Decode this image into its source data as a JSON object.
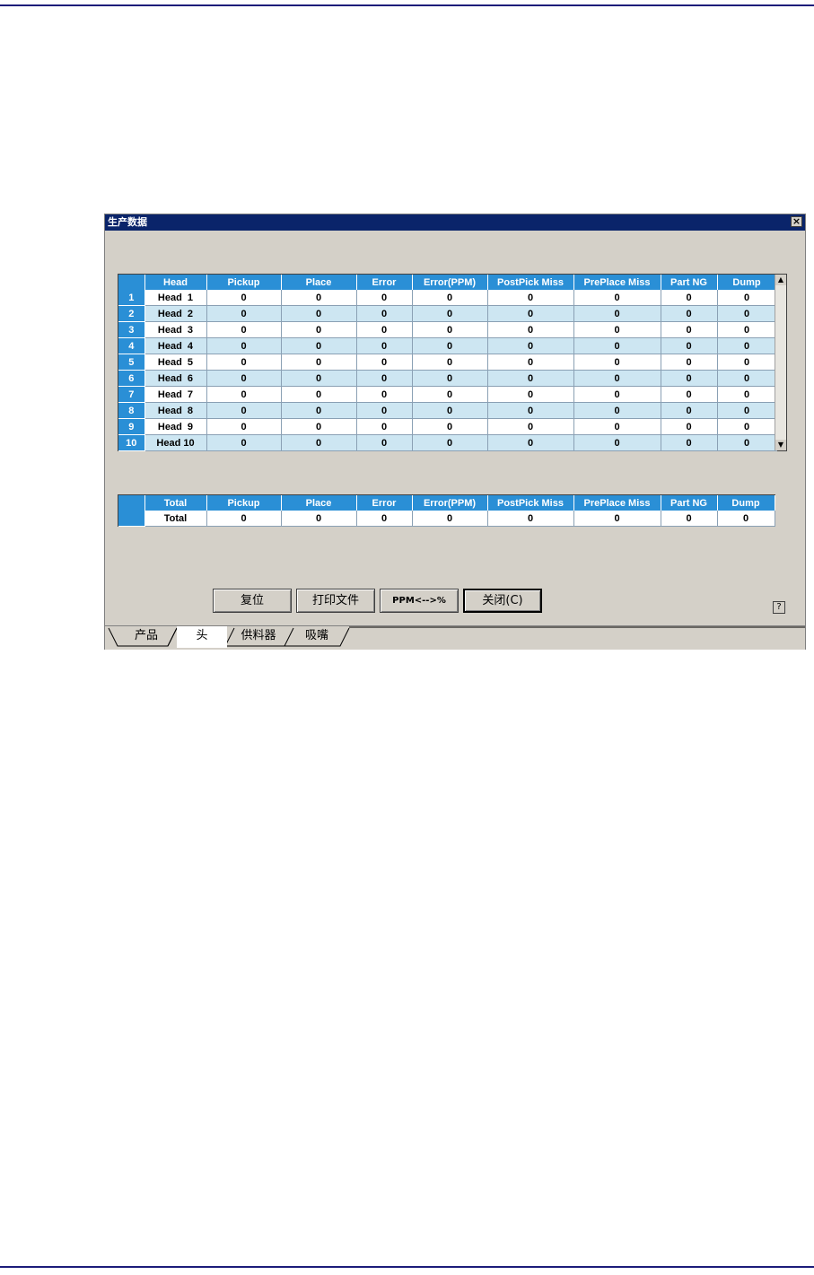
{
  "window": {
    "title": "生产数据"
  },
  "head_table": {
    "columns": [
      "",
      "Head",
      "Pickup",
      "Place",
      "Error",
      "Error(PPM)",
      "PostPick Miss",
      "PrePlace Miss",
      "Part NG",
      "Dump"
    ],
    "rows": [
      {
        "num": "1",
        "name": "Head  1",
        "pickup": "0",
        "place": "0",
        "error": "0",
        "error_ppm": "0",
        "postpick_miss": "0",
        "preplace_miss": "0",
        "part_ng": "0",
        "dump": "0"
      },
      {
        "num": "2",
        "name": "Head  2",
        "pickup": "0",
        "place": "0",
        "error": "0",
        "error_ppm": "0",
        "postpick_miss": "0",
        "preplace_miss": "0",
        "part_ng": "0",
        "dump": "0"
      },
      {
        "num": "3",
        "name": "Head  3",
        "pickup": "0",
        "place": "0",
        "error": "0",
        "error_ppm": "0",
        "postpick_miss": "0",
        "preplace_miss": "0",
        "part_ng": "0",
        "dump": "0"
      },
      {
        "num": "4",
        "name": "Head  4",
        "pickup": "0",
        "place": "0",
        "error": "0",
        "error_ppm": "0",
        "postpick_miss": "0",
        "preplace_miss": "0",
        "part_ng": "0",
        "dump": "0"
      },
      {
        "num": "5",
        "name": "Head  5",
        "pickup": "0",
        "place": "0",
        "error": "0",
        "error_ppm": "0",
        "postpick_miss": "0",
        "preplace_miss": "0",
        "part_ng": "0",
        "dump": "0"
      },
      {
        "num": "6",
        "name": "Head  6",
        "pickup": "0",
        "place": "0",
        "error": "0",
        "error_ppm": "0",
        "postpick_miss": "0",
        "preplace_miss": "0",
        "part_ng": "0",
        "dump": "0"
      },
      {
        "num": "7",
        "name": "Head  7",
        "pickup": "0",
        "place": "0",
        "error": "0",
        "error_ppm": "0",
        "postpick_miss": "0",
        "preplace_miss": "0",
        "part_ng": "0",
        "dump": "0"
      },
      {
        "num": "8",
        "name": "Head  8",
        "pickup": "0",
        "place": "0",
        "error": "0",
        "error_ppm": "0",
        "postpick_miss": "0",
        "preplace_miss": "0",
        "part_ng": "0",
        "dump": "0"
      },
      {
        "num": "9",
        "name": "Head  9",
        "pickup": "0",
        "place": "0",
        "error": "0",
        "error_ppm": "0",
        "postpick_miss": "0",
        "preplace_miss": "0",
        "part_ng": "0",
        "dump": "0"
      },
      {
        "num": "10",
        "name": "Head 10",
        "pickup": "0",
        "place": "0",
        "error": "0",
        "error_ppm": "0",
        "postpick_miss": "0",
        "preplace_miss": "0",
        "part_ng": "0",
        "dump": "0"
      }
    ]
  },
  "total_table": {
    "columns": [
      "",
      "Total",
      "Pickup",
      "Place",
      "Error",
      "Error(PPM)",
      "PostPick Miss",
      "PrePlace Miss",
      "Part NG",
      "Dump"
    ],
    "rows": [
      {
        "num": "",
        "name": "Total",
        "pickup": "0",
        "place": "0",
        "error": "0",
        "error_ppm": "0",
        "postpick_miss": "0",
        "preplace_miss": "0",
        "part_ng": "0",
        "dump": "0"
      }
    ]
  },
  "buttons": {
    "reset": "复位",
    "print": "打印文件",
    "ppm_toggle": "PPM<-->%",
    "close": "关闭(C)",
    "help": "?"
  },
  "tabs": [
    "产品",
    "头",
    "供料器",
    "吸嘴"
  ],
  "active_tab": "头",
  "icons": {
    "close": "close-icon",
    "help": "help-icon",
    "scroll_up": "scroll-up-icon",
    "scroll_down": "scroll-down-icon"
  },
  "colors": {
    "header_blue": "#2a8fd6",
    "alt_row": "#cde6f2",
    "titlebar": "#0a246a",
    "window_bg": "#d4d0c8"
  }
}
